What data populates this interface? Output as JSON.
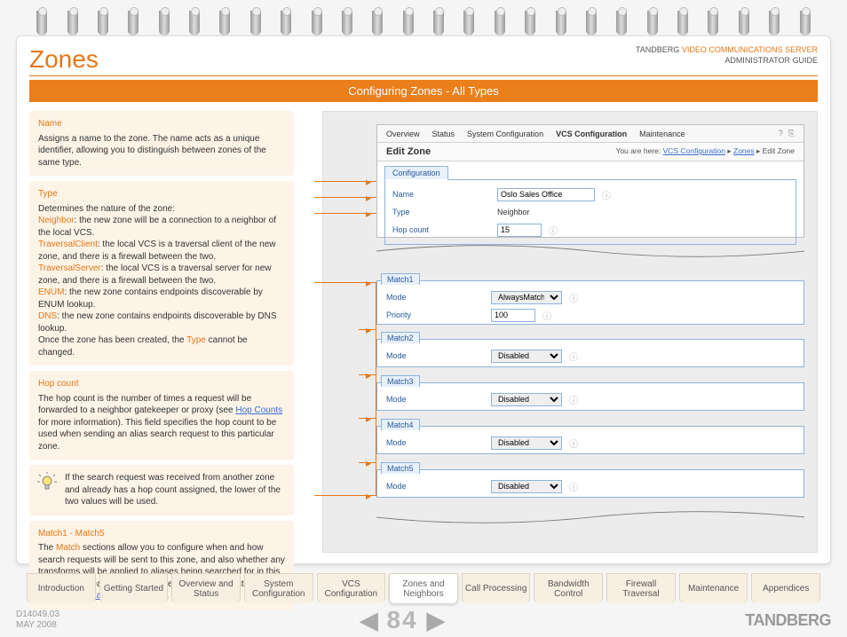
{
  "header": {
    "title": "Zones",
    "product_line1_a": "TANDBERG ",
    "product_line1_b": "VIDEO COMMUNICATIONS SERVER",
    "product_line2": "ADMINISTRATOR GUIDE"
  },
  "orange_bar": "Configuring Zones - All Types",
  "blocks": {
    "name": {
      "title": "Name",
      "body": "Assigns a name to the zone.  The name acts as a unique identifier, allowing you to distinguish between zones of the same type."
    },
    "type": {
      "title": "Type",
      "intro": "Determines the nature of the zone:",
      "neighbor_term": "Neighbor",
      "neighbor_body": ": the new zone will be a connection to a neighbor of the local VCS.",
      "tc_term": "TraversalClient",
      "tc_body": ": the local VCS is a traversal client of the new zone, and there is a firewall between the two.",
      "ts_term": "TraversalServer",
      "ts_body": ": the local VCS is a traversal server for new zone, and there is a firewall between the two.",
      "enum_term": "ENUM",
      "enum_body": ": the new zone contains endpoints discoverable by ENUM lookup.",
      "dns_term": "DNS",
      "dns_body": ": the new zone contains endpoints discoverable by DNS lookup.",
      "outro_a": "Once the zone has been created, the ",
      "outro_term": "Type",
      "outro_b": " cannot be changed."
    },
    "hop": {
      "title": "Hop count",
      "body_a": "The hop count is the number of times a request will be forwarded to a neighbor gatekeeper or proxy (see ",
      "link": "Hop Counts",
      "body_b": " for more information).  This field specifies the hop count to be used when sending an alias search request to this particular zone."
    },
    "tip": "If the search request was received from another zone and already has a hop count assigned, the lower of the two values will be used.",
    "match": {
      "title": "Match1 - Match5",
      "body_a": "The ",
      "term": "Match",
      "body_b": " sections allow you to configure when and how search requests will be sent to this zone, and also whether any transforms will be applied to aliases being searched for in this zone.  These features are described in full in the section ",
      "link": "Zone searching and alias transforming",
      "body_c": "."
    }
  },
  "app": {
    "tabs": {
      "overview": "Overview",
      "status": "Status",
      "sysconf": "System Configuration",
      "vcsconf": "VCS Configuration",
      "maint": "Maintenance"
    },
    "edit_title": "Edit Zone",
    "breadcrumb_a": "You are here: ",
    "breadcrumb_b": "VCS Configuration",
    "breadcrumb_c": " ▸ ",
    "breadcrumb_d": "Zones",
    "breadcrumb_e": " ▸ Edit Zone",
    "conf_tab": "Configuration",
    "fields": {
      "name_lbl": "Name",
      "name_val": "Oslo Sales Office",
      "type_lbl": "Type",
      "type_val": "Neighbor",
      "hop_lbl": "Hop count",
      "hop_val": "15",
      "mode_lbl": "Mode",
      "priority_lbl": "Priority",
      "priority_val": "100",
      "mode_always": "AlwaysMatch",
      "mode_disabled": "Disabled"
    },
    "matches": [
      "Match1",
      "Match2",
      "Match3",
      "Match4",
      "Match5"
    ]
  },
  "navtabs": [
    "Introduction",
    "Getting Started",
    "Overview and Status",
    "System Configuration",
    "VCS Configuration",
    "Zones and Neighbors",
    "Call Processing",
    "Bandwidth Control",
    "Firewall Traversal",
    "Maintenance",
    "Appendices"
  ],
  "footer": {
    "docid": "D14049.03",
    "date": "MAY 2008",
    "page": "84",
    "brand": "TANDBERG"
  }
}
